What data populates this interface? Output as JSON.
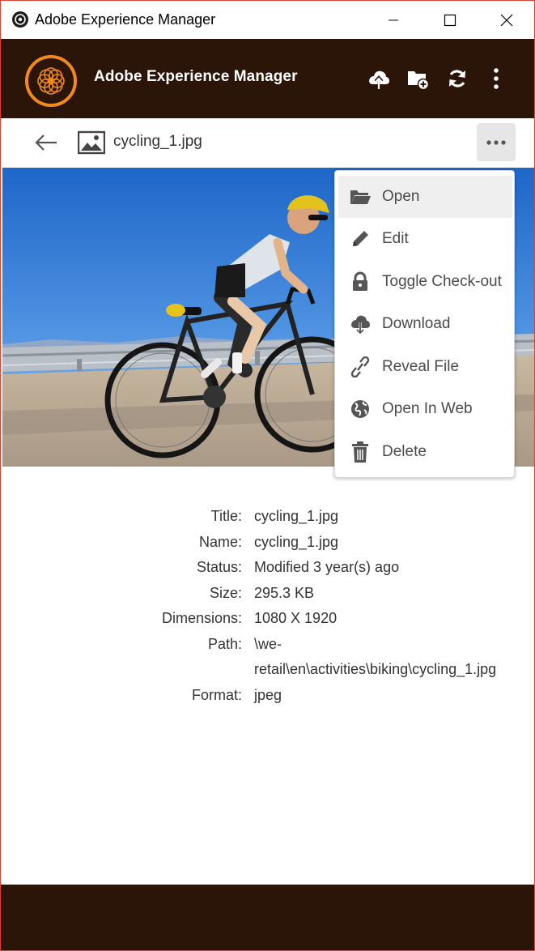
{
  "window": {
    "title": "Adobe Experience Manager"
  },
  "header": {
    "app_name": "Adobe Experience Manager",
    "actions": [
      "upload-icon",
      "new-folder-icon",
      "sync-icon",
      "more-vertical-icon"
    ]
  },
  "toolbar": {
    "file_name": "cycling_1.jpg"
  },
  "menu": {
    "items": [
      {
        "label": "Open",
        "icon": "folder-open-icon"
      },
      {
        "label": "Edit",
        "icon": "pencil-icon"
      },
      {
        "label": "Toggle Check-out",
        "icon": "lock-icon"
      },
      {
        "label": "Download",
        "icon": "download-icon"
      },
      {
        "label": "Reveal File",
        "icon": "link-icon"
      },
      {
        "label": "Open In Web",
        "icon": "globe-icon"
      },
      {
        "label": "Delete",
        "icon": "trash-icon"
      }
    ]
  },
  "details": {
    "title_label": "Title:",
    "title_value": "cycling_1.jpg",
    "name_label": "Name:",
    "name_value": "cycling_1.jpg",
    "status_label": "Status:",
    "status_value": "Modified 3 year(s) ago",
    "size_label": "Size:",
    "size_value": "295.3 KB",
    "dimensions_label": "Dimensions:",
    "dimensions_value": "1080 X 1920",
    "path_label": "Path:",
    "path_value_line1": "\\we-",
    "path_value_line2": "retail\\en\\activities\\biking\\cycling_1.jpg",
    "format_label": "Format:",
    "format_value": "jpeg"
  },
  "colors": {
    "brand_dark": "#2b1408",
    "logo_orange": "#f08a1c",
    "window_border": "#e04030"
  }
}
